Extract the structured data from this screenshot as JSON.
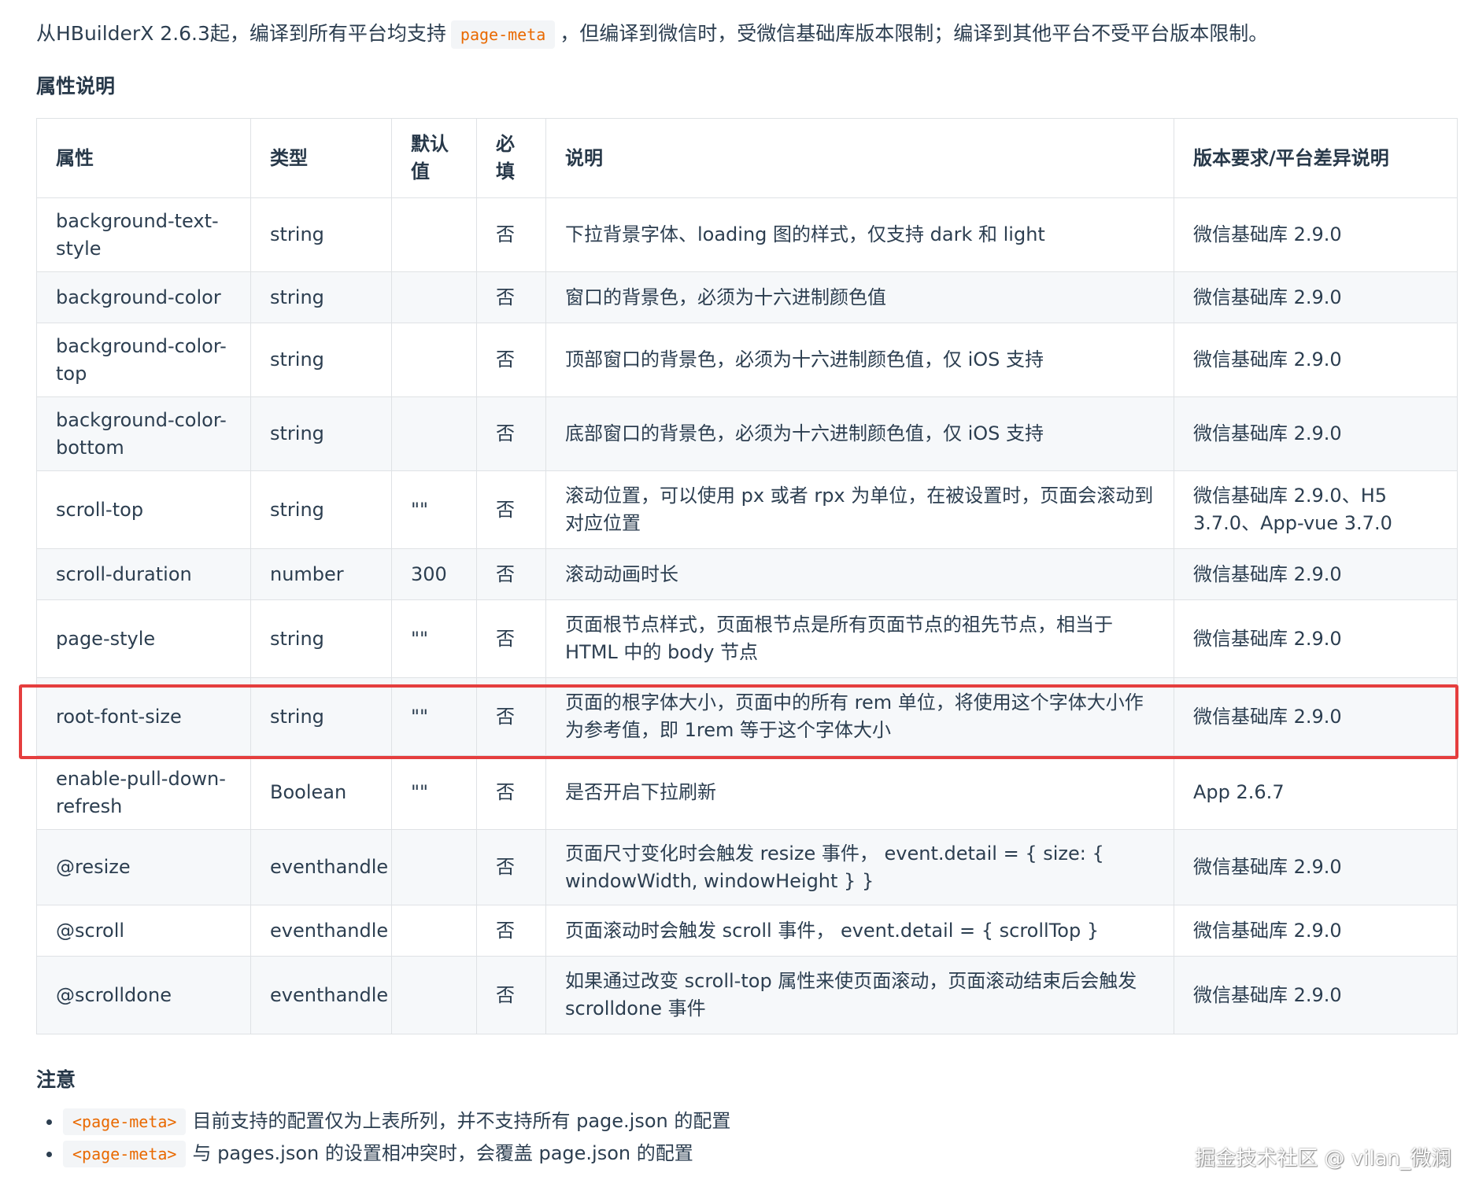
{
  "intro": {
    "before": "从HBuilderX 2.6.3起，编译到所有平台均支持",
    "code": "page-meta",
    "after": "，但编译到微信时，受微信基础库版本限制；编译到其他平台不受平台版本限制。"
  },
  "section_props_title": "属性说明",
  "table": {
    "headers": [
      "属性",
      "类型",
      "默认值",
      "必填",
      "说明",
      "版本要求/平台差异说明"
    ],
    "rows": [
      {
        "attr": "background-text-style",
        "type": "string",
        "default": "",
        "required": "否",
        "desc": "下拉背景字体、loading 图的样式，仅支持 dark 和 light",
        "version": "微信基础库 2.9.0"
      },
      {
        "attr": "background-color",
        "type": "string",
        "default": "",
        "required": "否",
        "desc": "窗口的背景色，必须为十六进制颜色值",
        "version": "微信基础库 2.9.0"
      },
      {
        "attr": "background-color-top",
        "type": "string",
        "default": "",
        "required": "否",
        "desc": "顶部窗口的背景色，必须为十六进制颜色值，仅 iOS 支持",
        "version": "微信基础库 2.9.0"
      },
      {
        "attr": "background-color-bottom",
        "type": "string",
        "default": "",
        "required": "否",
        "desc": "底部窗口的背景色，必须为十六进制颜色值，仅 iOS 支持",
        "version": "微信基础库 2.9.0"
      },
      {
        "attr": "scroll-top",
        "type": "string",
        "default": "\"\"",
        "required": "否",
        "desc": "滚动位置，可以使用 px 或者 rpx 为单位，在被设置时，页面会滚动到对应位置",
        "version": "微信基础库 2.9.0、H5 3.7.0、App-vue 3.7.0"
      },
      {
        "attr": "scroll-duration",
        "type": "number",
        "default": "300",
        "required": "否",
        "desc": "滚动动画时长",
        "version": "微信基础库 2.9.0"
      },
      {
        "attr": "page-style",
        "type": "string",
        "default": "\"\"",
        "required": "否",
        "desc": "页面根节点样式，页面根节点是所有页面节点的祖先节点，相当于 HTML 中的 body 节点",
        "version": "微信基础库 2.9.0"
      },
      {
        "attr": "root-font-size",
        "type": "string",
        "default": "\"\"",
        "required": "否",
        "desc": "页面的根字体大小，页面中的所有 rem 单位，将使用这个字体大小作为参考值，即 1rem 等于这个字体大小",
        "version": "微信基础库 2.9.0"
      },
      {
        "attr": "enable-pull-down-refresh",
        "type": "Boolean",
        "default": "\"\"",
        "required": "否",
        "desc": "是否开启下拉刷新",
        "version": "App 2.6.7"
      },
      {
        "attr": "@resize",
        "type": "eventhandle",
        "default": "",
        "required": "否",
        "desc": "页面尺寸变化时会触发 resize 事件， event.detail = { size: { windowWidth, windowHeight } }",
        "version": "微信基础库 2.9.0"
      },
      {
        "attr": "@scroll",
        "type": "eventhandle",
        "default": "",
        "required": "否",
        "desc": "页面滚动时会触发 scroll 事件， event.detail = { scrollTop }",
        "version": "微信基础库 2.9.0"
      },
      {
        "attr": "@scrolldone",
        "type": "eventhandle",
        "default": "",
        "required": "否",
        "desc": "如果通过改变 scroll-top 属性来使页面滚动，页面滚动结束后会触发 scrolldone 事件",
        "version": "微信基础库 2.9.0"
      }
    ]
  },
  "section_notes_title": "注意",
  "notes": [
    {
      "code": "<page-meta>",
      "text": "目前支持的配置仅为上表所列，并不支持所有 page.json 的配置"
    },
    {
      "code": "<page-meta>",
      "text": "与 pages.json 的设置相冲突时，会覆盖 page.json 的配置"
    }
  ],
  "watermark": "掘金技术社区 @ vilan_微澜",
  "colors": {
    "highlight_border": "#e53e3e",
    "code_text": "#e96900",
    "text": "#2c3e50"
  }
}
